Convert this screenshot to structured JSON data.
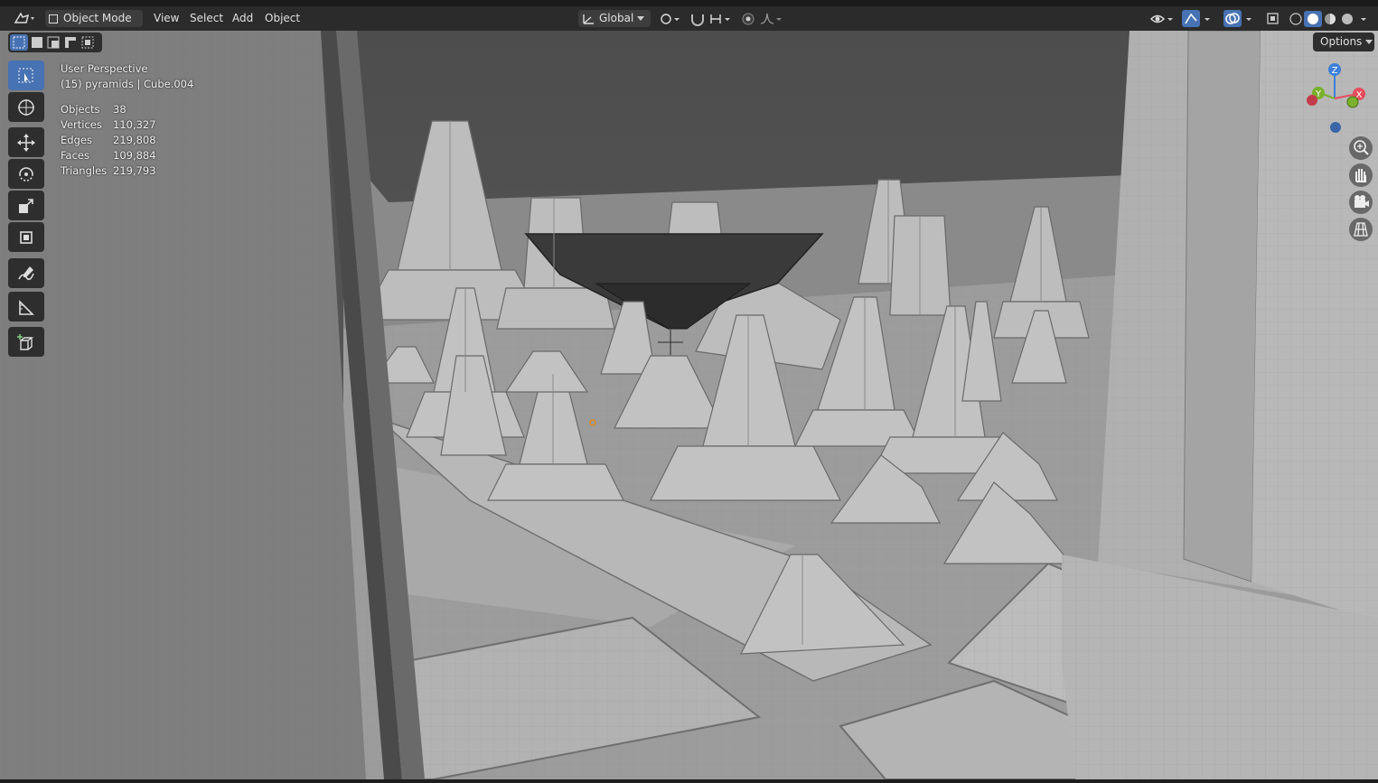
{
  "header": {
    "mode_label": "Object Mode",
    "menus": [
      "View",
      "Select",
      "Add",
      "Object"
    ],
    "transform_orientation": "Global",
    "options_label": "Options"
  },
  "overlay_info": {
    "view_name": "User Perspective",
    "context": "(15) pyramids | Cube.004",
    "stats": [
      {
        "label": "Objects",
        "value": "38"
      },
      {
        "label": "Vertices",
        "value": "110,327"
      },
      {
        "label": "Edges",
        "value": "219,808"
      },
      {
        "label": "Faces",
        "value": "109,884"
      },
      {
        "label": "Triangles",
        "value": "219,793"
      }
    ]
  },
  "gizmo": {
    "x_label": "X",
    "y_label": "Y",
    "z_label": "Z"
  },
  "colors": {
    "active_tool": "#4772b3",
    "axis_x": "#e44d5d",
    "axis_y": "#7ab02c",
    "axis_z": "#3d7fd9",
    "viewport_background": "#5a5a5a"
  },
  "tools": [
    "select-box-icon",
    "cursor-icon",
    "move-icon",
    "rotate-icon",
    "scale-icon",
    "transform-icon",
    "annotate-icon",
    "measure-icon",
    "add-cube-icon"
  ]
}
